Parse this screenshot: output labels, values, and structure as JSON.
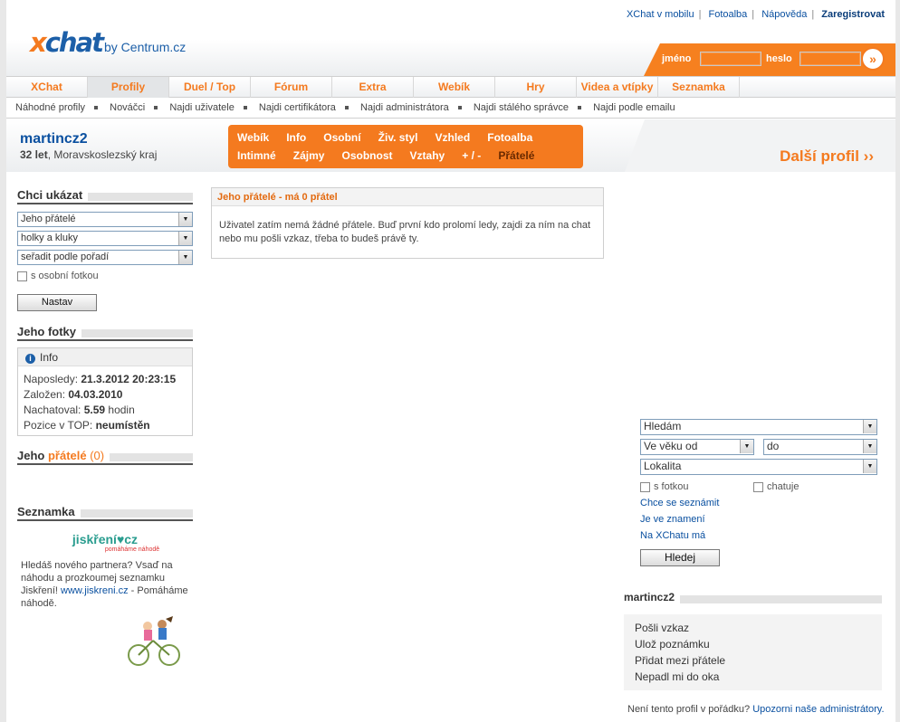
{
  "header": {
    "toplinks": [
      "XChat v mobilu",
      "Fotoalba",
      "Nápověda",
      "Zaregistrovat"
    ],
    "logo": {
      "x": "x",
      "chat": "chat",
      "by": "by Centrum.cz"
    },
    "login": {
      "name_label": "jméno",
      "pass_label": "heslo",
      "go": "»"
    }
  },
  "nav": {
    "tabs": [
      "XChat",
      "Profily",
      "Duel / Top",
      "Fórum",
      "Extra",
      "Webík",
      "Hry",
      "Videa a vtípky",
      "Seznamka"
    ],
    "active": "Profily"
  },
  "subnav": [
    "Náhodné profily",
    "Nováčci",
    "Najdi uživatele",
    "Najdi certifikátora",
    "Najdi administrátora",
    "Najdi stálého správce",
    "Najdi podle emailu"
  ],
  "profile": {
    "name": "martincz2",
    "age": "32 let",
    "region": ", Moravskoslezský kraj",
    "menu_row1": [
      "Webík",
      "Info",
      "Osobní",
      "Živ. styl",
      "Vzhled",
      "Fotoalba"
    ],
    "menu_row2": [
      "Intimné",
      "Zájmy",
      "Osobnost",
      "Vztahy",
      "+ / -",
      "Přátelé"
    ],
    "next": "Další profil ››"
  },
  "left": {
    "show_title": "Chci ukázat",
    "select1": "Jeho přátelé",
    "select2": "holky a kluky",
    "select3": "seřadit podle pořadí",
    "photo_check": "s osobní fotkou",
    "set_button": "Nastav",
    "photos_title": "Jeho fotky",
    "info": {
      "title": "Info",
      "last_label": "Naposledy: ",
      "last_value": "21.3.2012 20:23:15",
      "created_label": "Založen: ",
      "created_value": "04.03.2010",
      "chat_label": "Nachatoval: ",
      "chat_value": "5.59",
      "chat_unit": " hodin",
      "top_label": "Pozice v TOP: ",
      "top_value": "neumístěn"
    },
    "friends_title_a": "Jeho ",
    "friends_title_b": "přátelé",
    "friends_count": " (0)",
    "dating_title": "Seznamka",
    "dating_logo": "jiskření♥cz",
    "dating_tag": "pomáháme náhodě",
    "dating_text_a": "Hledáš nového partnera? Vsaď na náhodu a prozkoumej seznamku Jiskření! ",
    "dating_link": "www.jiskreni.cz",
    "dating_text_b": " - Pomáháme náhodě."
  },
  "center": {
    "title": "Jeho přátelé - má 0 přátel",
    "body": "Uživatel zatím nemá žádné přátele. Buď první kdo prolomí ledy, zajdi za ním na chat nebo mu pošli vzkaz, třeba to budeš právě ty."
  },
  "search": {
    "select_hledam": "Hledám",
    "select_age_from": "Ve věku od",
    "select_age_to": "do",
    "select_locality": "Lokalita",
    "check_photo": "s fotkou",
    "check_chat": "chatuje",
    "links": [
      "Chce se seznámit",
      "Je ve znamení",
      "Na XChatu má"
    ],
    "button": "Hledej"
  },
  "rprofile": {
    "title": "martincz2",
    "actions": [
      "Pošli vzkaz",
      "Ulož poznámku",
      "Přidat mezi přátele",
      "Nepadl mi do oka"
    ]
  },
  "report": {
    "text": "Není tento profil v pořádku? ",
    "link": "Upozorni naše administrátory."
  },
  "colors": {
    "orange": "#f47a1f",
    "blue": "#0a50a0"
  }
}
